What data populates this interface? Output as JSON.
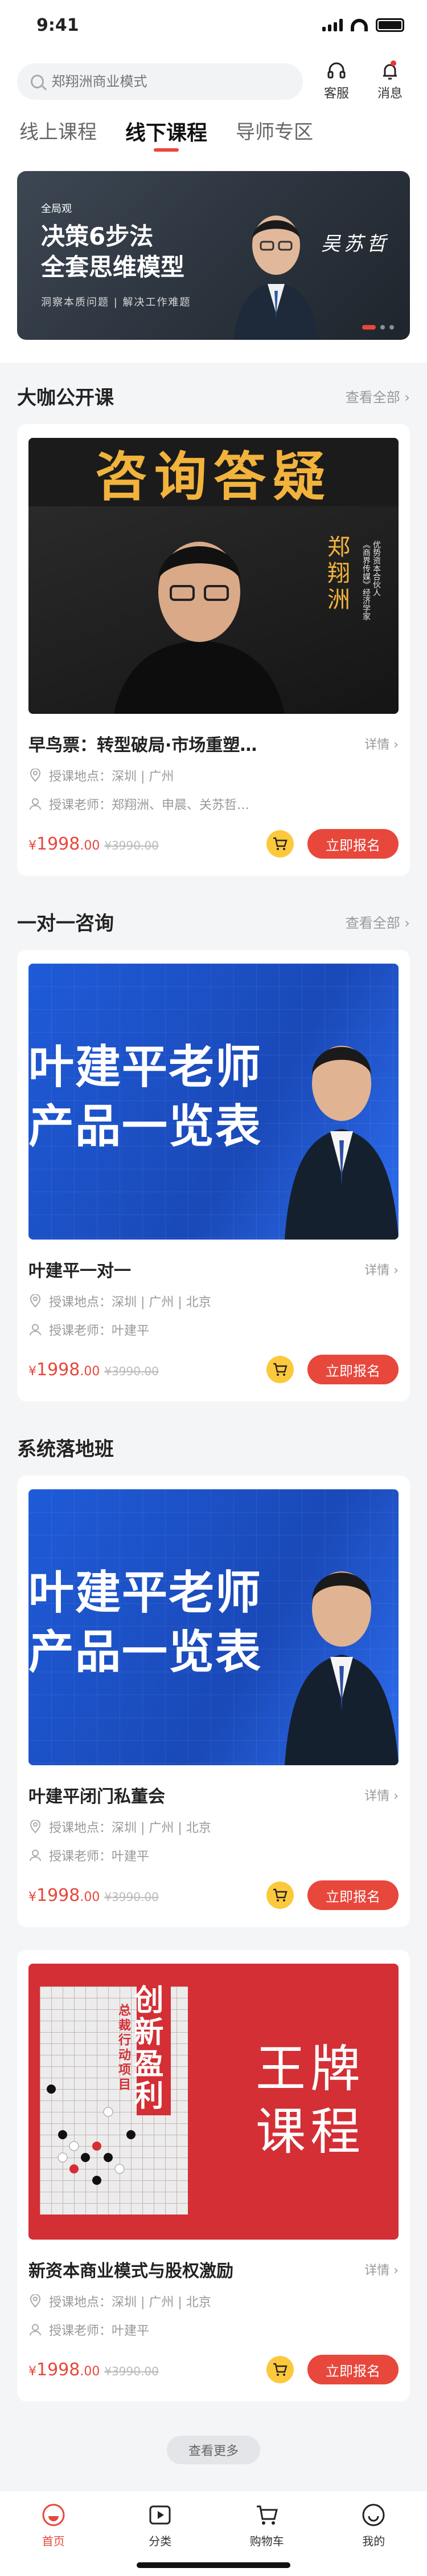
{
  "status_bar": {
    "time": "9:41"
  },
  "header": {
    "search_placeholder": "郑翔洲商业模式",
    "service_label": "客服",
    "message_label": "消息"
  },
  "tabs": [
    {
      "label": "线上课程",
      "active": false
    },
    {
      "label": "线下课程",
      "active": true
    },
    {
      "label": "导师专区",
      "active": false
    }
  ],
  "banner": {
    "tag": "全局观",
    "title_line1": "决策6步法",
    "title_line2": "全套思维模型",
    "subtitle": "洞察本质问题  |  解决工作难题",
    "signature": "吴苏哲",
    "active_slide": 1,
    "slide_count": 3
  },
  "sections": [
    {
      "title": "大咖公开课",
      "more": "查看全部",
      "card": {
        "poster_headline": "咨询答疑",
        "poster_name": "郑翔洲",
        "poster_desc1": "优势资本合伙人",
        "poster_desc2": "《商界传媒》经济学家",
        "title": "早鸟票：转型破局·市场重塑…",
        "detail": "详情",
        "location": "授课地点：深圳 | 广州",
        "teacher": "授课老师：郑翔洲、申晨、关苏哲…",
        "price_symbol": "¥",
        "price_int": "1998",
        "price_dec": ".00",
        "orig_price": "¥3990.00",
        "signup": "立即报名"
      }
    },
    {
      "title": "一对一咨询",
      "more": "查看全部",
      "card": {
        "poster_line1": "叶建平老师",
        "poster_line2": "产品一览表",
        "title": "叶建平一对一",
        "detail": "详情",
        "location": "授课地点：深圳 | 广州 | 北京",
        "teacher": "授课老师：叶建平",
        "price_symbol": "¥",
        "price_int": "1998",
        "price_dec": ".00",
        "orig_price": "¥3990.00",
        "signup": "立即报名"
      }
    },
    {
      "title": "系统落地班",
      "more": "",
      "cards": [
        {
          "poster_line1": "叶建平老师",
          "poster_line2": "产品一览表",
          "title": "叶建平闭门私董会",
          "detail": "详情",
          "location": "授课地点：深圳 | 广州 | 北京",
          "teacher": "授课老师：叶建平",
          "price_symbol": "¥",
          "price_int": "1998",
          "price_dec": ".00",
          "orig_price": "¥3990.00",
          "signup": "立即报名"
        },
        {
          "poster_vertical_main": "创新盈利",
          "poster_vertical_sub": "总裁行动项目",
          "poster_right_line1": "王牌",
          "poster_right_line2": "课程",
          "title": "新资本商业模式与股权激励",
          "detail": "详情",
          "location": "授课地点：深圳 | 广州 | 北京",
          "teacher": "授课老师：叶建平",
          "price_symbol": "¥",
          "price_int": "1998",
          "price_dec": ".00",
          "orig_price": "¥3990.00",
          "signup": "立即报名"
        }
      ]
    }
  ],
  "load_more": "查看更多",
  "bottom_nav": [
    {
      "label": "首页",
      "icon": "home-icon",
      "active": true
    },
    {
      "label": "分类",
      "icon": "play-icon",
      "active": false
    },
    {
      "label": "购物车",
      "icon": "cart-icon",
      "active": false
    },
    {
      "label": "我的",
      "icon": "profile-icon",
      "active": false
    }
  ],
  "colors": {
    "accent": "#e8473c",
    "cart_yellow": "#fcc93c",
    "poster_blue": "#1f5bd8",
    "poster_red": "#d32f35",
    "poster_gold": "#f2b33d"
  }
}
